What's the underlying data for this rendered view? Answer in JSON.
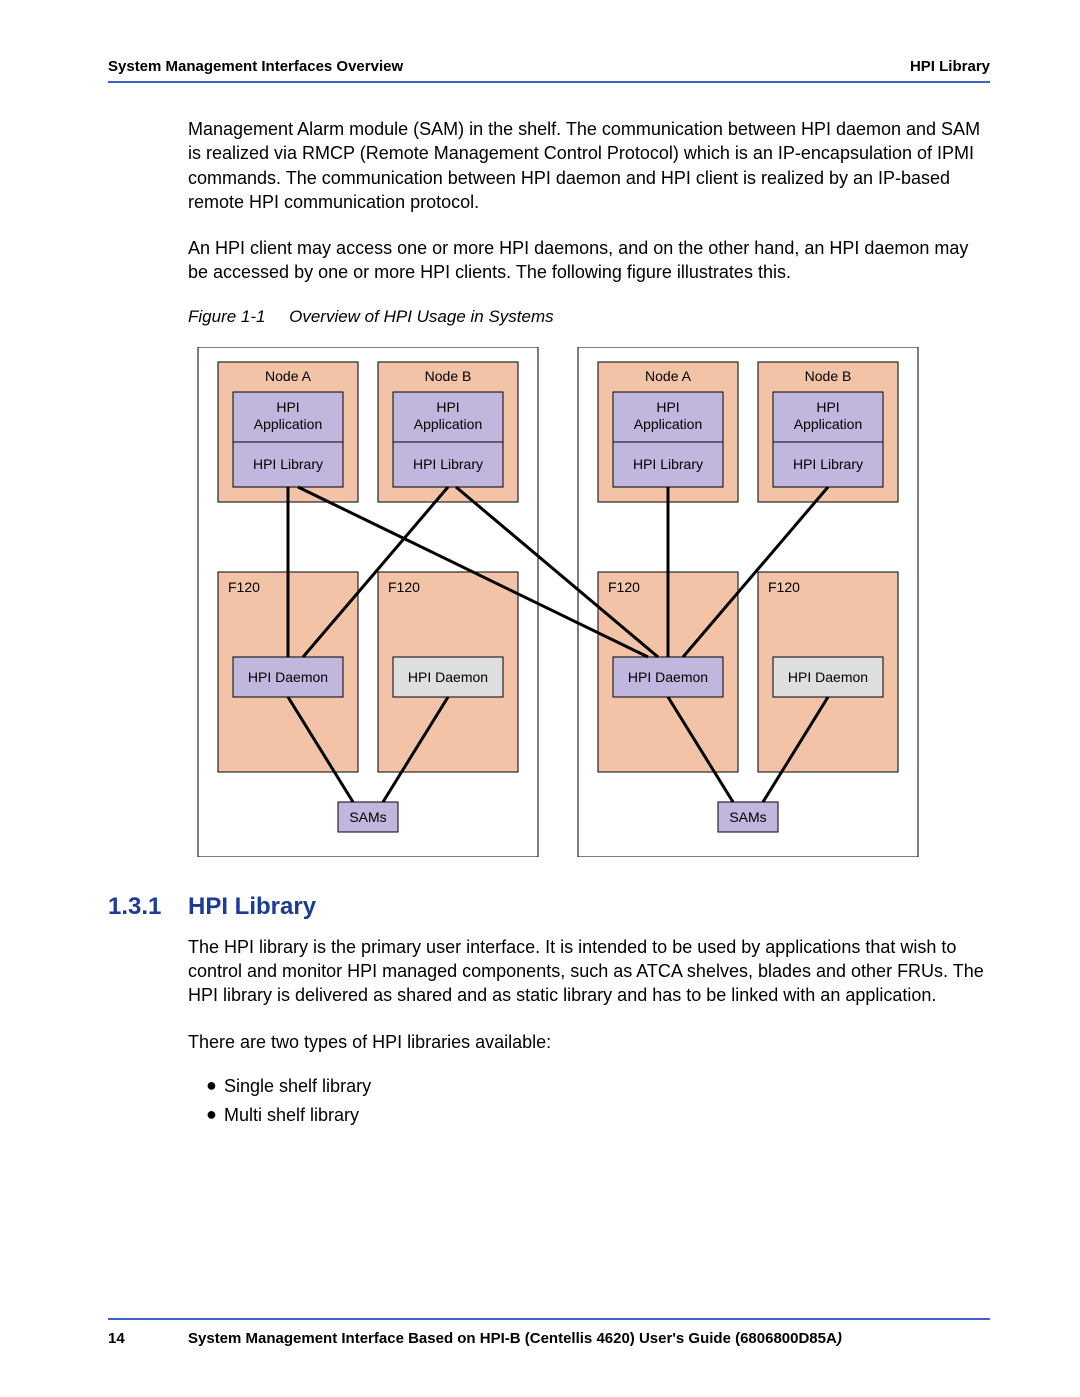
{
  "header": {
    "left": "System Management Interfaces Overview",
    "right": "HPI Library"
  },
  "paragraphs": {
    "p1": "Management Alarm module (SAM) in the shelf. The communication between HPI daemon and SAM is realized via RMCP (Remote Management Control Protocol) which is an IP-encapsulation of IPMI commands. The communication between HPI daemon and HPI client is realized by an IP-based remote HPI communication protocol.",
    "p2": "An HPI client may access one or more HPI daemons, and on the other hand, an HPI daemon may be accessed by one or more HPI clients. The following figure illustrates this."
  },
  "figure_caption": {
    "label": "Figure 1-1",
    "title": "Overview of HPI Usage in Systems"
  },
  "diagram": {
    "shelves": [
      {
        "nodes": [
          {
            "label": "Node A",
            "app": "HPI Application",
            "lib": "HPI Library"
          },
          {
            "label": "Node B",
            "app": "HPI Application",
            "lib": "HPI Library"
          }
        ],
        "f120": [
          {
            "label": "F120",
            "daemon": "HPI Daemon"
          },
          {
            "label": "F120",
            "daemon": "HPI Daemon"
          }
        ],
        "sam": "SAMs"
      },
      {
        "nodes": [
          {
            "label": "Node A",
            "app": "HPI Application",
            "lib": "HPI Library"
          },
          {
            "label": "Node B",
            "app": "HPI Application",
            "lib": "HPI Library"
          }
        ],
        "f120": [
          {
            "label": "F120",
            "daemon": "HPI Daemon"
          },
          {
            "label": "F120",
            "daemon": "HPI Daemon"
          }
        ],
        "sam": "SAMs"
      }
    ]
  },
  "section": {
    "number": "1.3.1",
    "title": "HPI Library",
    "p1": "The HPI library is the primary user interface. It is intended to be used by applications that wish to control and monitor HPI managed components, such as ATCA shelves, blades and other FRUs. The HPI library is delivered as shared and as static library and has to be linked with an application.",
    "p2": "There are two types of HPI libraries available:",
    "bullets": [
      "Single shelf library",
      "Multi shelf library"
    ]
  },
  "footer": {
    "page": "14",
    "text": "System Management Interface Based on HPI-B (Centellis 4620) User's Guide (6806800D85A",
    "text_suffix": ")"
  }
}
